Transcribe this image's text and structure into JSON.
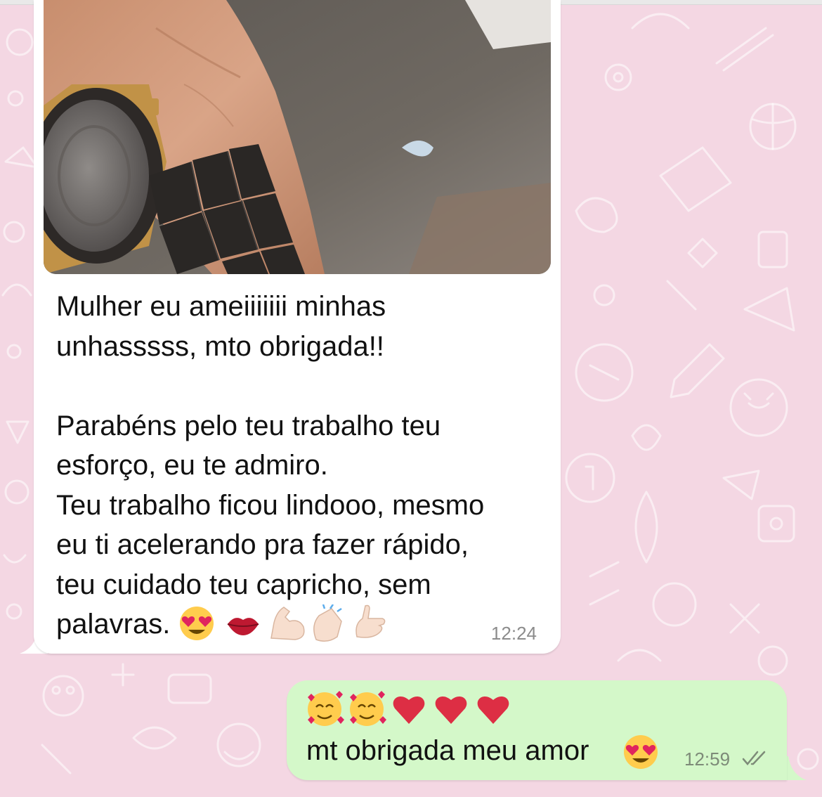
{
  "incoming": {
    "text": "Mulher eu ameiiiiiii minhas\nunhasssss, mto obrigada!!\n\nParabéns pelo teu trabalho teu\nesforço, eu te admiro.\nTeu trabalho ficou lindooo, mesmo\neu ti acelerando pra fazer rápido,\nteu cuidado teu capricho, sem\npalavras.",
    "emojis": [
      "heart-eyes-emoji",
      "kiss-lips-emoji",
      "flexed-biceps-emoji",
      "clapping-hands-emoji",
      "call-me-hand-emoji"
    ],
    "time": "12:24"
  },
  "outgoing": {
    "emojis": [
      "smiling-face-with-hearts-emoji",
      "smiling-face-with-hearts-emoji",
      "red-heart-emoji",
      "red-heart-emoji",
      "red-heart-emoji"
    ],
    "text": "mt obrigada meu amor",
    "trailing_emoji": "heart-eyes-emoji",
    "time": "12:59",
    "status_icon": "double-check-read-icon"
  },
  "colors": {
    "wallpaper": "#f4d7e3",
    "incoming_bubble": "#ffffff",
    "outgoing_bubble": "#d4f8c9"
  }
}
